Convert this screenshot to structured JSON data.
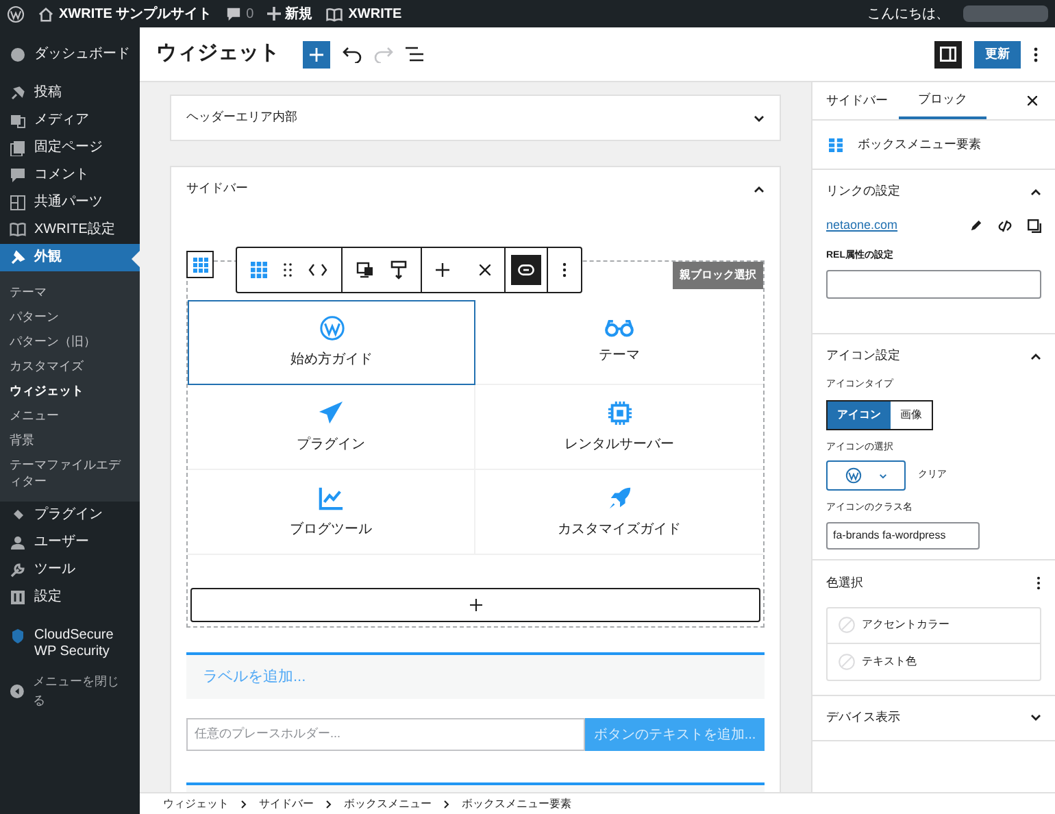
{
  "admin_bar": {
    "site": "XWRITE サンプルサイト",
    "comments": "0",
    "new": "新規",
    "theme": "XWRITE",
    "greeting": "こんにちは、"
  },
  "header": {
    "title": "ウィジェット",
    "redo_disabled": true,
    "sidebar_toggle_on": true,
    "update": "更新"
  },
  "menu": [
    {
      "label": "ダッシュボード",
      "selected": false
    },
    {
      "label": "投稿",
      "selected": false
    },
    {
      "label": "メディア",
      "selected": false
    },
    {
      "label": "固定ページ",
      "selected": false
    },
    {
      "label": "コメント",
      "selected": false
    },
    {
      "label": "共通パーツ",
      "selected": false
    },
    {
      "label": "XWRITE設定",
      "selected": false
    },
    {
      "label": "外観",
      "selected": true,
      "children": [
        {
          "label": "テーマ",
          "selected": false
        },
        {
          "label": "パターン",
          "selected": false
        },
        {
          "label": "パターン（旧）",
          "selected": false
        },
        {
          "label": "カスタマイズ",
          "selected": false
        },
        {
          "label": "ウィジェット",
          "selected": true
        },
        {
          "label": "メニュー",
          "selected": false
        },
        {
          "label": "背景",
          "selected": false
        },
        {
          "label": "テーマファイルエディター",
          "selected": false
        }
      ]
    },
    {
      "label": "プラグイン",
      "selected": false
    },
    {
      "label": "ユーザー",
      "selected": false
    },
    {
      "label": "ツール",
      "selected": false
    },
    {
      "label": "設定",
      "selected": false
    },
    {
      "label": "CloudSecure WP Security",
      "selected": false
    }
  ],
  "collapse_menu": "メニューを閉じる",
  "areas": [
    {
      "title": "ヘッダーエリア内部",
      "expanded": false
    },
    {
      "title": "サイドバー",
      "expanded": true
    }
  ],
  "box_menu": {
    "parent_select": "親ブロック選択",
    "link_on": true,
    "items": [
      {
        "label": "始め方ガイド",
        "selected": true
      },
      {
        "label": "テーマ",
        "selected": false
      },
      {
        "label": "プラグイン",
        "selected": false
      },
      {
        "label": "レンタルサーバー",
        "selected": false
      },
      {
        "label": "ブログツール",
        "selected": false
      },
      {
        "label": "カスタマイズガイド",
        "selected": false
      }
    ]
  },
  "label_placeholder": "ラベルを追加...",
  "search": {
    "placeholder": "任意のプレースホルダー...",
    "button": "ボタンのテキストを追加..."
  },
  "breadcrumb": [
    "ウィジェット",
    "サイドバー",
    "ボックスメニュー",
    "ボックスメニュー要素"
  ],
  "inspector": {
    "tabs": [
      {
        "label": "サイドバー",
        "selected": false
      },
      {
        "label": "ブロック",
        "selected": true
      }
    ],
    "block_title": "ボックスメニュー要素",
    "link": {
      "title": "リンクの設定",
      "expanded": true,
      "url": "netaone.com",
      "rel_label": "REL属性の設定"
    },
    "icon": {
      "title": "アイコン設定",
      "expanded": true,
      "type_label": "アイコンタイプ",
      "types": [
        {
          "label": "アイコン",
          "selected": true
        },
        {
          "label": "画像",
          "selected": false
        }
      ],
      "select_label": "アイコンの選択",
      "clear": "クリア",
      "class_label": "アイコンのクラス名",
      "class_value": "fa-brands fa-wordpress"
    },
    "color": {
      "title": "色選択",
      "items": [
        "アクセントカラー",
        "テキスト色"
      ]
    },
    "device": {
      "title": "デバイス表示",
      "expanded": false
    }
  }
}
